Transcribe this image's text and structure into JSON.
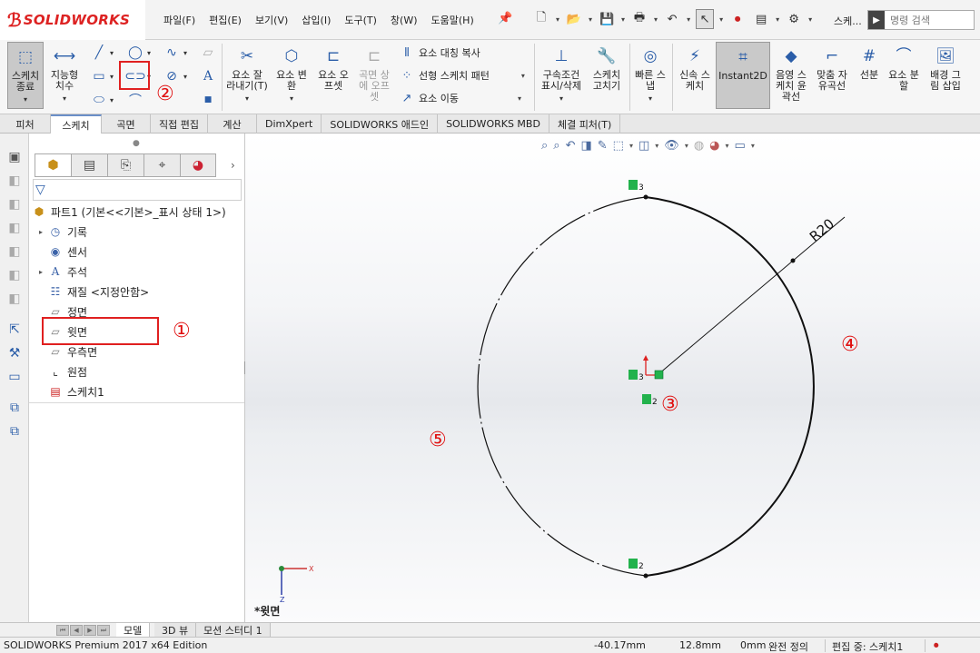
{
  "app": {
    "brand": "SOLIDWORKS",
    "menus": [
      "파일(F)",
      "편집(E)",
      "보기(V)",
      "삽입(I)",
      "도구(T)",
      "창(W)",
      "도움말(H)"
    ],
    "doc_label": "스케...",
    "search_placeholder": "명령 검색"
  },
  "ribbon": {
    "exit_sketch": [
      "스케치",
      "종료"
    ],
    "smart_dimension": [
      "지능형",
      "치수"
    ],
    "trim": [
      "요소 잘",
      "라내기(T)"
    ],
    "convert": [
      "요소 변",
      "환"
    ],
    "offset": [
      "요소 오",
      "프셋"
    ],
    "surface_offset": [
      "곡면 상",
      "에 오프",
      "셋"
    ],
    "mirror": "요소 대칭 복사",
    "linear_pattern": "선형 스케치 패턴",
    "move": "요소 이동",
    "relations": [
      "구속조건",
      "표시/삭제"
    ],
    "repair": [
      "스케치",
      "고치기"
    ],
    "quick_snap": [
      "빠른 스",
      "냅"
    ],
    "rapid_sketch": [
      "신속 스",
      "케치"
    ],
    "instant2d": "Instant2D",
    "shaded_contour": [
      "음영 스",
      "케치 윤",
      "곽선"
    ],
    "fit_spline": [
      "맞춤 자",
      "유곡선"
    ],
    "sketch_text": "선분",
    "split": [
      "요소 분",
      "할"
    ],
    "sketch_picture": [
      "배경 그",
      "림 삽입"
    ]
  },
  "tabs": [
    "피처",
    "스케치",
    "곡면",
    "직접 편집",
    "계산",
    "DimXpert",
    "SOLIDWORKS 애드인",
    "SOLIDWORKS MBD",
    "체결 피처(T)"
  ],
  "active_tab": "스케치",
  "tree": {
    "part": "파트1  (기본<<기본>_표시 상태 1>)",
    "items": [
      "기록",
      "센서",
      "주석",
      "재질 <지정안함>",
      "정면",
      "윗면",
      "우측면",
      "원점",
      "스케치1"
    ]
  },
  "viewport": {
    "dimension": "R20",
    "view_name": "*윗면",
    "relation_labels": [
      "3",
      "3",
      "2",
      "2"
    ]
  },
  "annotations": [
    "①",
    "②",
    "③",
    "④",
    "⑤"
  ],
  "bottom_tabs": [
    "모델",
    "3D 뷰",
    "모션 스터디 1"
  ],
  "status": {
    "edition": "SOLIDWORKS Premium 2017 x64 Edition",
    "x": "-40.17mm",
    "y": "12.8mm",
    "z": "0mm",
    "state": "완전 정의",
    "editing": "편집 중: 스케치1"
  },
  "colors": {
    "accent_red": "#e01010",
    "relation_green": "#22b24c",
    "sketch_line": "#111111"
  }
}
